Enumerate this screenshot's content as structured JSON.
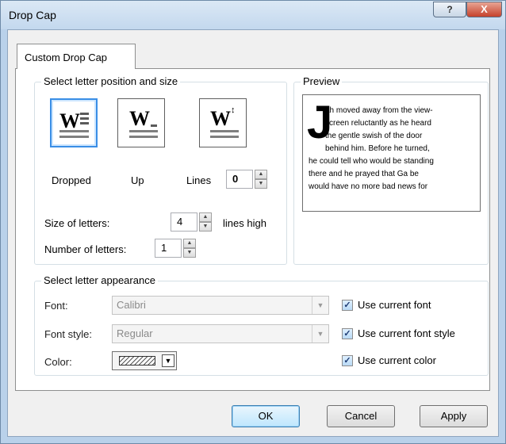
{
  "window": {
    "title": "Drop Cap",
    "help_glyph": "?",
    "close_glyph": "X"
  },
  "tab": {
    "label": "Custom Drop Cap"
  },
  "position": {
    "legend": "Select letter position and size",
    "options": [
      {
        "label": "Dropped",
        "glyph": "W",
        "selected": true
      },
      {
        "label": "Up",
        "glyph": "W",
        "selected": false
      },
      {
        "label": "Lines",
        "glyph": "W",
        "selected": false
      }
    ],
    "lines_value": "0",
    "size_label": "Size of letters:",
    "size_value": "4",
    "size_unit": "lines high",
    "number_label": "Number of letters:",
    "number_value": "1"
  },
  "preview": {
    "legend": "Preview",
    "dropcap": "J",
    "lines": [
      "ah moved away from the view-",
      "screen reluctantly as he heard",
      "the gentle swish of the door",
      "behind him.  Before he turned,",
      "he could tell who would be standing",
      "there and he prayed that Ga be",
      "would have no more bad news for"
    ]
  },
  "appearance": {
    "legend": "Select letter appearance",
    "font_label": "Font:",
    "font_value": "Calibri",
    "style_label": "Font style:",
    "style_value": "Regular",
    "color_label": "Color:",
    "use_font": "Use current font",
    "use_style": "Use current font style",
    "use_color": "Use current color"
  },
  "buttons": {
    "ok": "OK",
    "cancel": "Cancel",
    "apply": "Apply"
  },
  "icons": {
    "checkmark": "✓",
    "dropdown": "▼",
    "spin_up": "▲",
    "spin_down": "▼"
  }
}
